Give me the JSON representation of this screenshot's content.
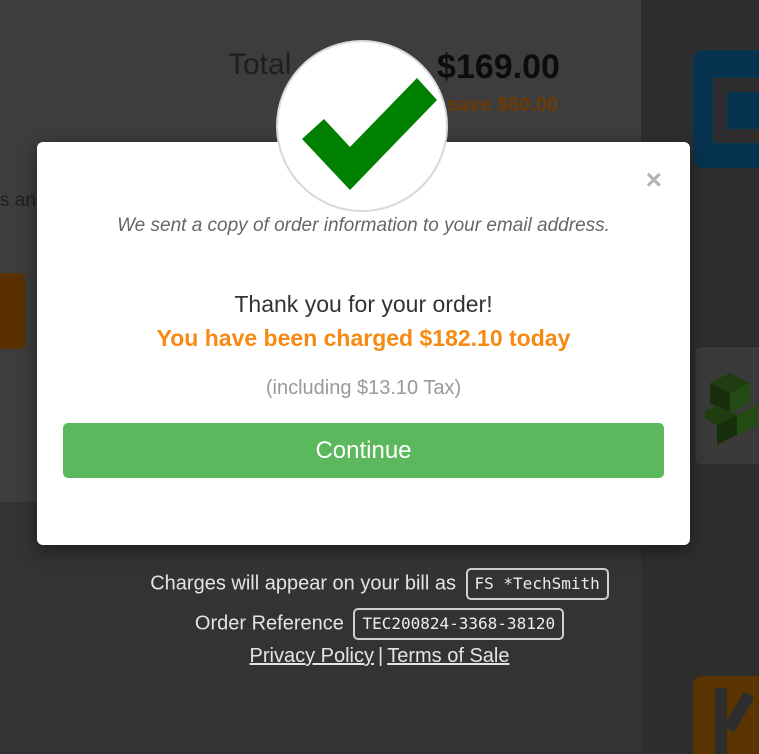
{
  "background": {
    "total_label": "Total",
    "total_price": "$169.00",
    "save_text": "save $80.00",
    "partial_text": "s and"
  },
  "modal": {
    "close_label": "×",
    "email_message": "We sent a copy of order information to your email address.",
    "thanks": "Thank you for your order!",
    "charged": "You have been charged $182.10 today",
    "tax_note": "(including $13.10 Tax)",
    "continue_label": "Continue"
  },
  "footer": {
    "charges_text": "Charges will appear on your bill as",
    "billing_descriptor": "FS *TechSmith",
    "order_ref_label": "Order Reference",
    "order_ref_value": "TEC200824-3368-38120",
    "privacy_link": "Privacy Policy",
    "separator": "|",
    "terms_link": "Terms of Sale"
  },
  "colors": {
    "accent_orange": "#f68a12",
    "button_green": "#5cb85c",
    "check_green": "#008000"
  },
  "icons": {
    "success": "checkmark-icon",
    "close": "close-icon"
  }
}
